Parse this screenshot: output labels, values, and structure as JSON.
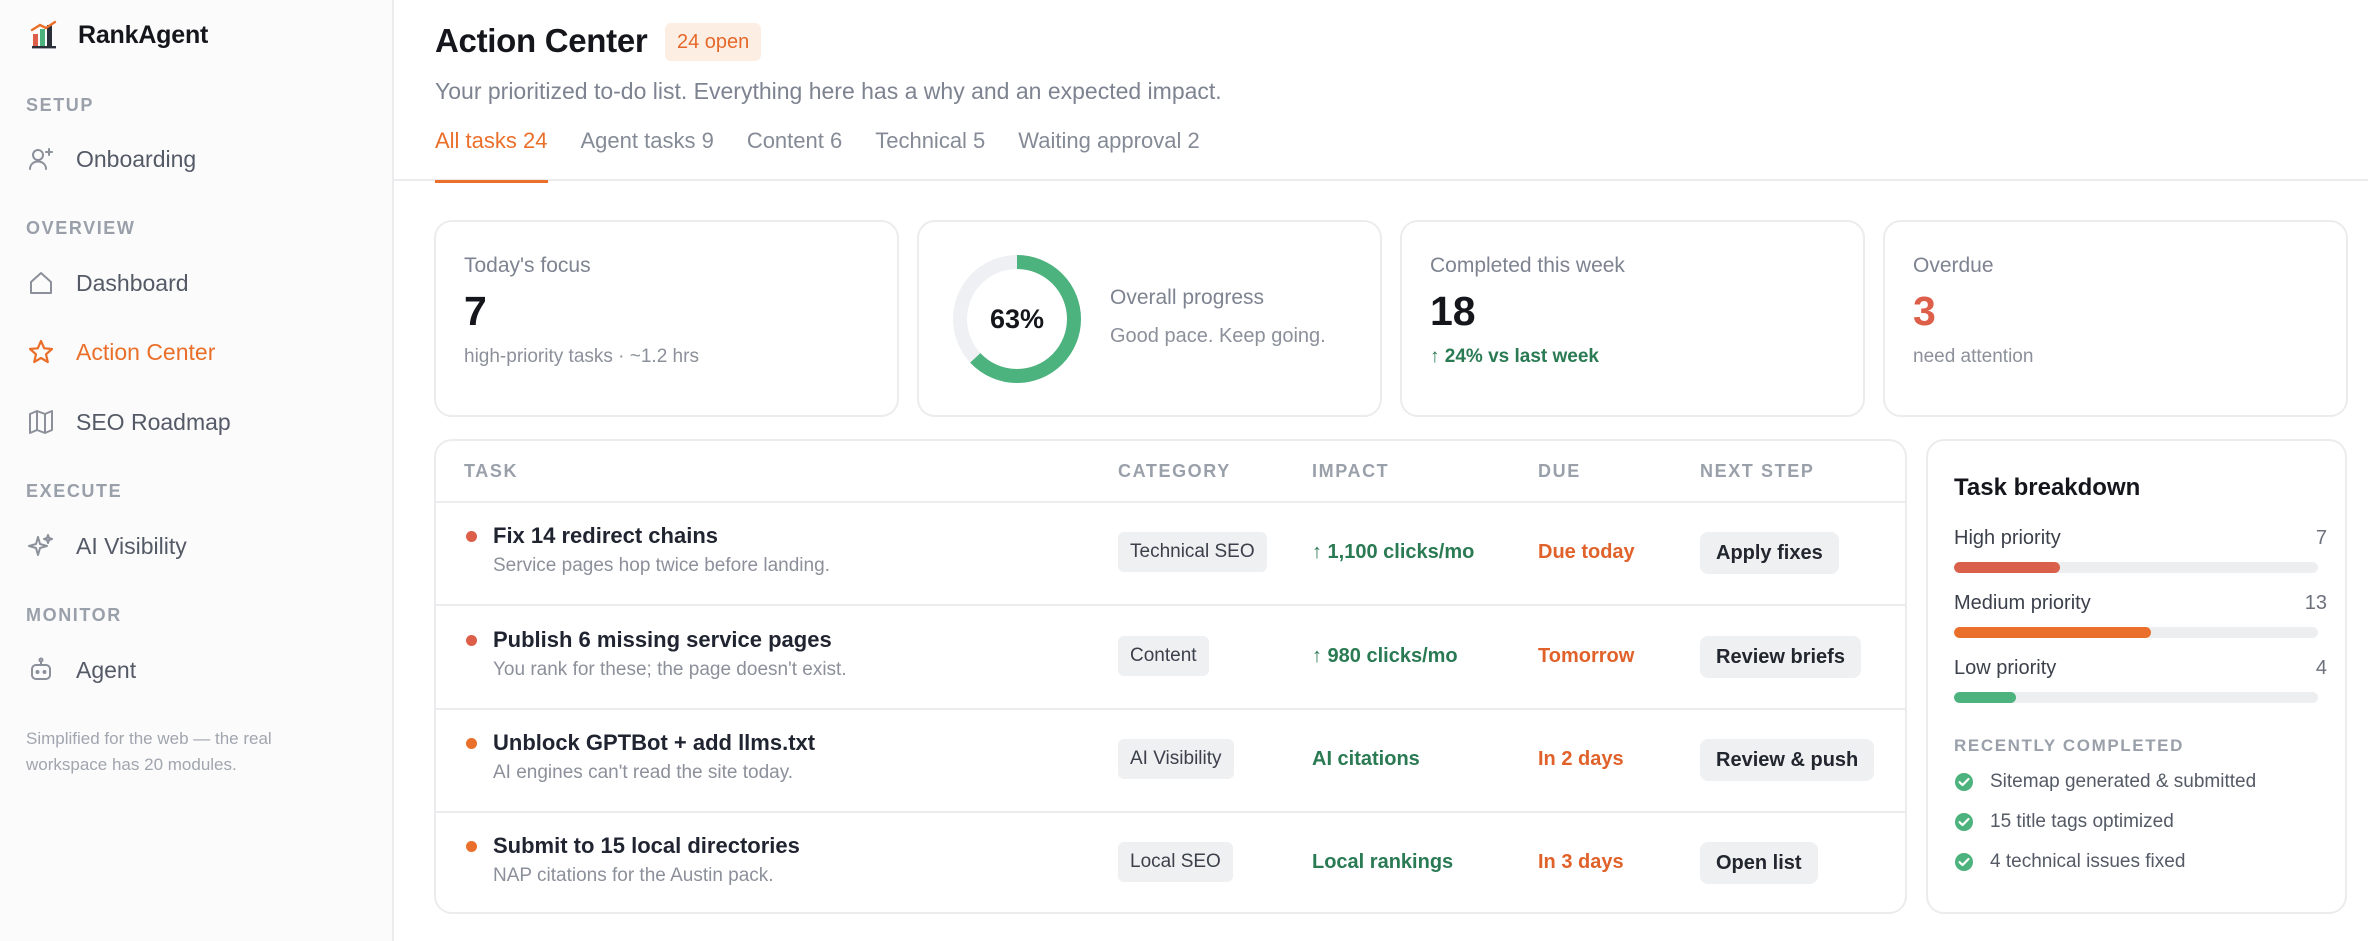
{
  "brand": {
    "name": "RankAgent"
  },
  "sidebar": {
    "sections": [
      {
        "label": "SETUP"
      },
      {
        "label": "OVERVIEW"
      },
      {
        "label": "EXECUTE"
      },
      {
        "label": "MONITOR"
      }
    ],
    "items": [
      {
        "label": "Onboarding",
        "icon": "user-plus-icon"
      },
      {
        "label": "Dashboard",
        "icon": "home-icon"
      },
      {
        "label": "Action Center",
        "icon": "star-icon",
        "active": true
      },
      {
        "label": "SEO Roadmap",
        "icon": "map-icon"
      },
      {
        "label": "AI Visibility",
        "icon": "sparkles-icon"
      },
      {
        "label": "Agent",
        "icon": "bot-icon"
      }
    ],
    "note": "Simplified for the web — the real workspace has 20 modules."
  },
  "header": {
    "title": "Action Center",
    "badge": "24 open",
    "subtitle": "Your prioritized to-do list. Everything here has a why and an expected impact.",
    "tabs": [
      {
        "label": "All tasks 24",
        "active": true
      },
      {
        "label": "Agent tasks 9"
      },
      {
        "label": "Content 6"
      },
      {
        "label": "Technical 5"
      },
      {
        "label": "Waiting approval 2"
      }
    ]
  },
  "stats": {
    "focus": {
      "label": "Today's focus",
      "value": "7",
      "sub": "high-priority tasks · ~1.2 hrs"
    },
    "progress": {
      "label": "Overall progress",
      "value": "63%",
      "percent": 63,
      "sub": "Good pace. Keep going."
    },
    "completed": {
      "label": "Completed this week",
      "value": "18",
      "sub": "↑ 24% vs last week"
    },
    "overdue": {
      "label": "Overdue",
      "value": "3",
      "sub": "need attention"
    }
  },
  "table": {
    "headers": {
      "task": "TASK",
      "category": "CATEGORY",
      "impact": "IMPACT",
      "due": "DUE",
      "next": "NEXT STEP"
    },
    "rows": [
      {
        "name": "Fix 14 redirect chains",
        "desc": "Service pages hop twice before landing.",
        "category": "Technical SEO",
        "impact": "↑ 1,100 clicks/mo",
        "due": "Due today",
        "action": "Apply fixes",
        "dot_color": "#dd5f49"
      },
      {
        "name": "Publish 6 missing service pages",
        "desc": "You rank for these; the page doesn't exist.",
        "category": "Content",
        "impact": "↑ 980 clicks/mo",
        "due": "Tomorrow",
        "action": "Review briefs",
        "dot_color": "#dd5f49"
      },
      {
        "name": "Unblock GPTBot + add llms.txt",
        "desc": "AI engines can't read the site today.",
        "category": "AI Visibility",
        "impact": "AI citations",
        "due": "In 2 days",
        "action": "Review & push",
        "dot_color": "#ea6f2a"
      },
      {
        "name": "Submit to 15 local directories",
        "desc": "NAP citations for the Austin pack.",
        "category": "Local SEO",
        "impact": "Local rankings",
        "due": "In 3 days",
        "action": "Open list",
        "dot_color": "#ea6f2a"
      }
    ]
  },
  "breakdown": {
    "title": "Task breakdown",
    "priorities": [
      {
        "label": "High priority",
        "count": "7",
        "fraction": 0.29,
        "color": "#d9604a"
      },
      {
        "label": "Medium priority",
        "count": "13",
        "fraction": 0.54,
        "color": "#ea6f2a"
      },
      {
        "label": "Low priority",
        "count": "4",
        "fraction": 0.17,
        "color": "#4cb27e"
      }
    ],
    "recent_label": "RECENTLY COMPLETED",
    "recent": [
      {
        "label": "Sitemap generated & submitted"
      },
      {
        "label": "15 title tags optimized"
      },
      {
        "label": "4 technical issues fixed"
      }
    ]
  },
  "colors": {
    "accent": "#ea6f2a",
    "success": "#2a7a53",
    "danger": "#dd5f49",
    "progress_ring": "#4cb27e"
  }
}
